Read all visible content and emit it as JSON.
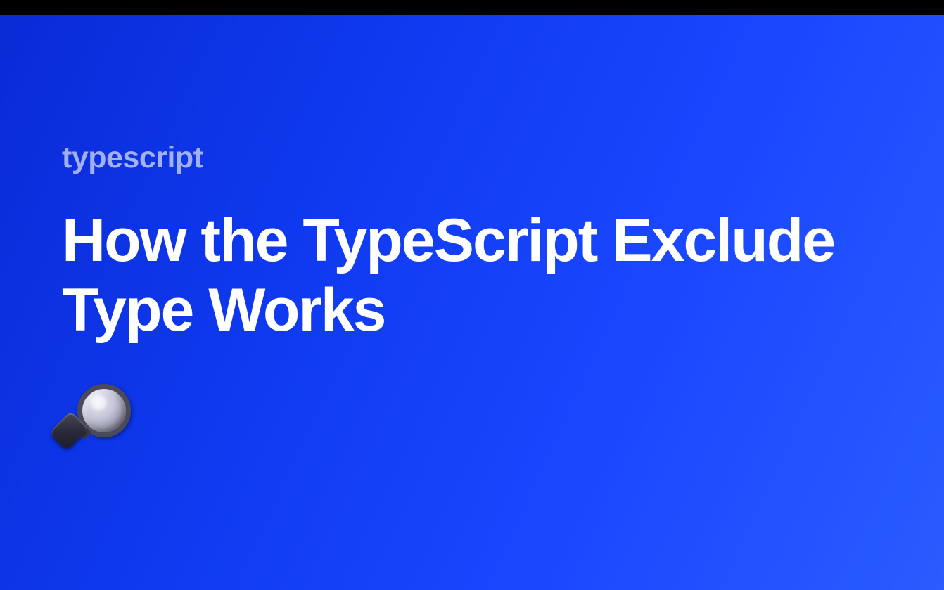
{
  "category": "typescript",
  "title": "How the TypeScript Exclude Type Works",
  "icon": "magnifying-glass"
}
